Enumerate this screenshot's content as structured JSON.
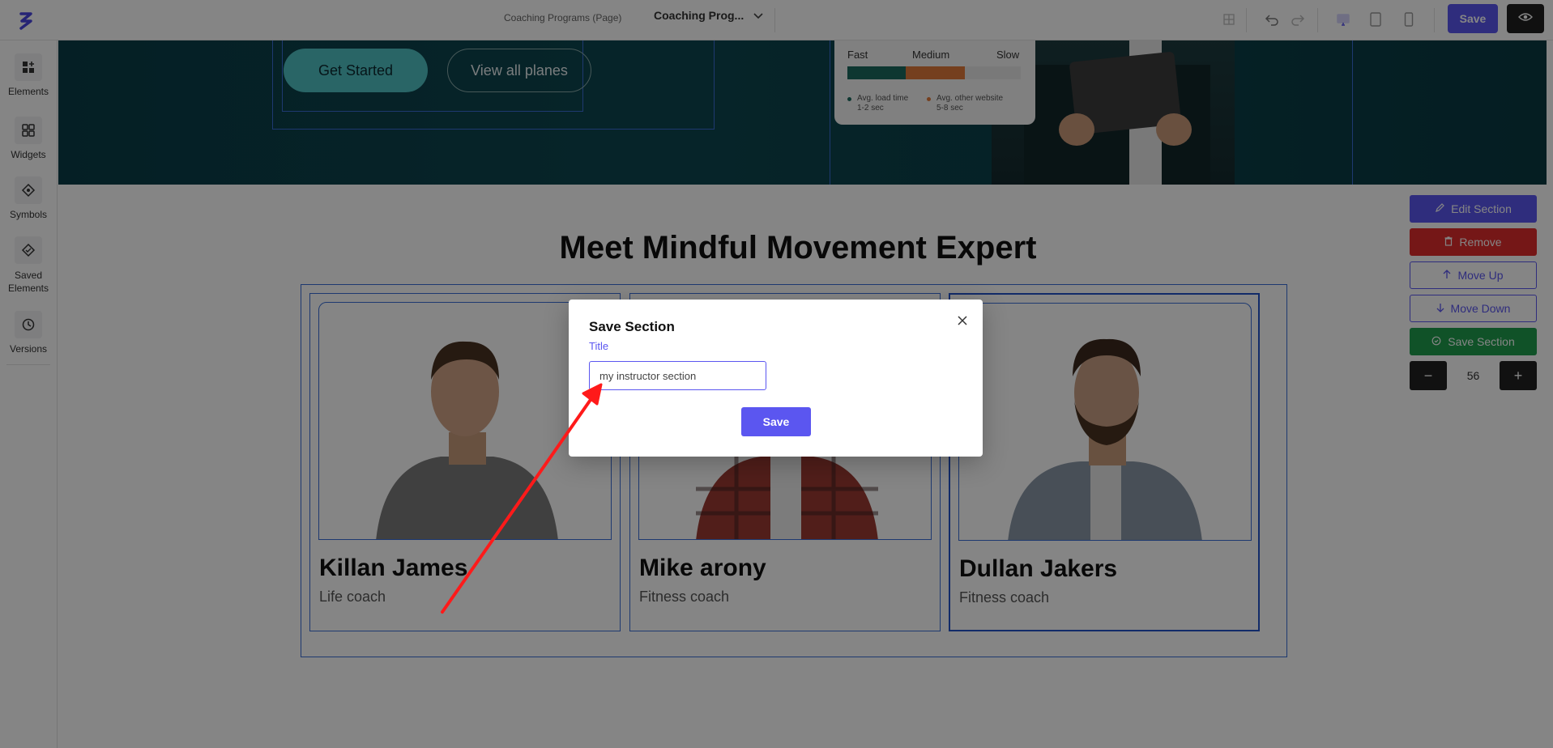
{
  "topbar": {
    "page_label": "Coaching Programs (Page)",
    "page_select": "Coaching Prog...",
    "save_label": "Save"
  },
  "sidebar": {
    "items": [
      {
        "label": "Elements",
        "icon": "elements-icon"
      },
      {
        "label": "Widgets",
        "icon": "widgets-icon"
      },
      {
        "label": "Symbols",
        "icon": "symbols-icon"
      },
      {
        "label": "Saved Elements",
        "icon": "saved-elements-icon"
      },
      {
        "label": "Versions",
        "icon": "versions-icon"
      }
    ]
  },
  "hero": {
    "get_started": "Get Started",
    "view_plans": "View all planes",
    "speed": {
      "fast": "Fast",
      "medium": "Medium",
      "slow": "Slow",
      "legend_1_line1": "Avg. load time",
      "legend_1_line2": "1-2 sec",
      "legend_2_line1": "Avg. other website",
      "legend_2_line2": "5-8 sec",
      "fast_color": "#1c6a5e",
      "medium_color": "#e07a3a"
    }
  },
  "section": {
    "title": "Meet Mindful Movement Expert",
    "cards": [
      {
        "name": "Killan James",
        "role": "Life coach"
      },
      {
        "name": "Mike arony",
        "role": "Fitness coach"
      },
      {
        "name": "Dullan Jakers",
        "role": "Fitness coach"
      }
    ]
  },
  "right_panel": {
    "edit": "Edit Section",
    "remove": "Remove",
    "move_up": "Move Up",
    "move_down": "Move Down",
    "save_section": "Save Section",
    "minus": "−",
    "value": "56",
    "plus": "+"
  },
  "modal": {
    "title": "Save Section",
    "label": "Title",
    "input_value": "my instructor section",
    "save": "Save"
  },
  "colors": {
    "accent": "#5b56f0",
    "danger": "#e02d2d",
    "success": "#1f9d4e",
    "annotation_arrow": "#ff1a1a"
  }
}
